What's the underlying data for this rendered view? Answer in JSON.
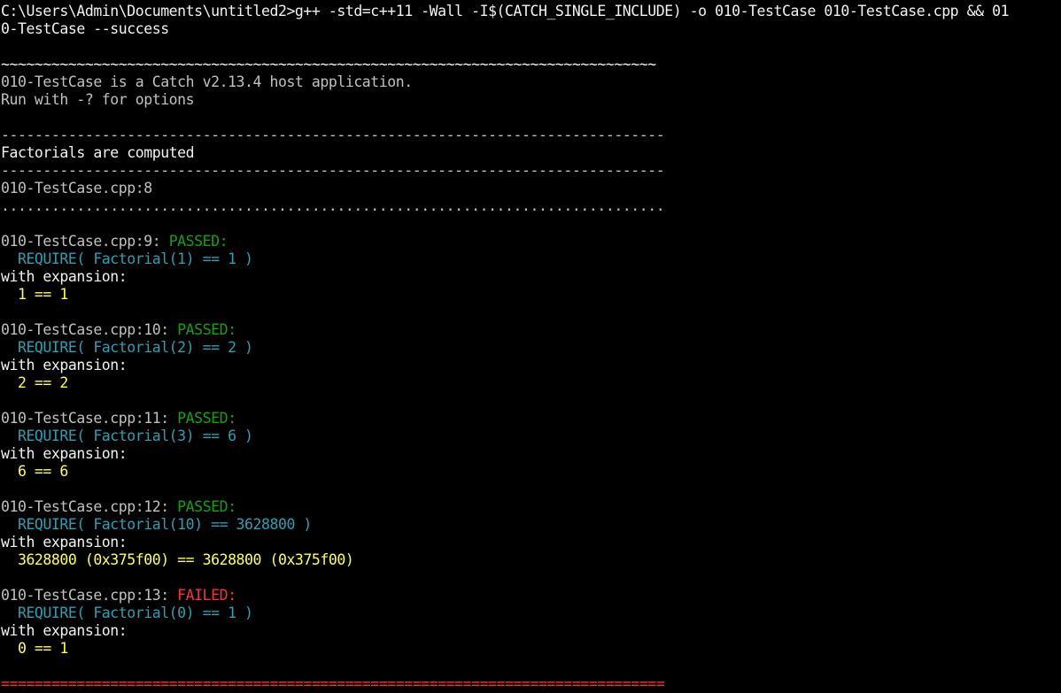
{
  "console": {
    "lines": [
      {
        "segments": [
          {
            "text": "C:\\Users\\Admin\\Documents\\untitled2>g++ -std=c++11 -Wall -I$(CATCH_SINGLE_INCLUDE) -o 010-TestCase 010-TestCase.cpp && 01",
            "color": "#f2f2f2"
          }
        ]
      },
      {
        "segments": [
          {
            "text": "0-TestCase --success",
            "color": "#f2f2f2"
          }
        ]
      },
      {
        "segments": [
          {
            "text": "",
            "color": "#c0c0c0"
          }
        ]
      },
      {
        "segments": [
          {
            "text": "~~~~~~~~~~~~~~~~~~~~~~~~~~~~~~~~~~~~~~~~~~~~~~~~~~~~~~~~~~~~~~~~~~~~~~~~~~~~~~",
            "color": "#f2f2f2"
          }
        ]
      },
      {
        "segments": [
          {
            "text": "010-TestCase is a Catch v2.13.4 host application.",
            "color": "#c0c0c0"
          }
        ]
      },
      {
        "segments": [
          {
            "text": "Run with -? for options",
            "color": "#c0c0c0"
          }
        ]
      },
      {
        "segments": [
          {
            "text": "",
            "color": "#c0c0c0"
          }
        ]
      },
      {
        "segments": [
          {
            "text": "-------------------------------------------------------------------------------",
            "color": "#c0c0c0"
          }
        ]
      },
      {
        "segments": [
          {
            "text": "Factorials are computed",
            "color": "#f2f2f2"
          }
        ]
      },
      {
        "segments": [
          {
            "text": "-------------------------------------------------------------------------------",
            "color": "#c0c0c0"
          }
        ]
      },
      {
        "segments": [
          {
            "text": "010-TestCase.cpp:8",
            "color": "#c0c0c0"
          }
        ]
      },
      {
        "segments": [
          {
            "text": "...............................................................................",
            "color": "#c0c0c0"
          }
        ]
      },
      {
        "segments": [
          {
            "text": "",
            "color": "#c0c0c0"
          }
        ]
      },
      {
        "segments": [
          {
            "text": "010-TestCase.cpp:9: ",
            "color": "#c0c0c0"
          },
          {
            "text": "PASSED:",
            "color": "#13a10e"
          }
        ]
      },
      {
        "segments": [
          {
            "text": "  REQUIRE( Factorial(1) == 1 )",
            "color": "#2aa1b3"
          }
        ]
      },
      {
        "segments": [
          {
            "text": "with expansion:",
            "color": "#f2f2f2"
          }
        ]
      },
      {
        "segments": [
          {
            "text": "  1 == 1",
            "color": "#ffff55"
          }
        ]
      },
      {
        "segments": [
          {
            "text": "",
            "color": "#c0c0c0"
          }
        ]
      },
      {
        "segments": [
          {
            "text": "010-TestCase.cpp:10: ",
            "color": "#c0c0c0"
          },
          {
            "text": "PASSED:",
            "color": "#13a10e"
          }
        ]
      },
      {
        "segments": [
          {
            "text": "  REQUIRE( Factorial(2) == 2 )",
            "color": "#2aa1b3"
          }
        ]
      },
      {
        "segments": [
          {
            "text": "with expansion:",
            "color": "#f2f2f2"
          }
        ]
      },
      {
        "segments": [
          {
            "text": "  2 == 2",
            "color": "#ffff55"
          }
        ]
      },
      {
        "segments": [
          {
            "text": "",
            "color": "#c0c0c0"
          }
        ]
      },
      {
        "segments": [
          {
            "text": "010-TestCase.cpp:11: ",
            "color": "#c0c0c0"
          },
          {
            "text": "PASSED:",
            "color": "#13a10e"
          }
        ]
      },
      {
        "segments": [
          {
            "text": "  REQUIRE( Factorial(3) == 6 )",
            "color": "#2aa1b3"
          }
        ]
      },
      {
        "segments": [
          {
            "text": "with expansion:",
            "color": "#f2f2f2"
          }
        ]
      },
      {
        "segments": [
          {
            "text": "  6 == 6",
            "color": "#ffff55"
          }
        ]
      },
      {
        "segments": [
          {
            "text": "",
            "color": "#c0c0c0"
          }
        ]
      },
      {
        "segments": [
          {
            "text": "010-TestCase.cpp:12: ",
            "color": "#c0c0c0"
          },
          {
            "text": "PASSED:",
            "color": "#13a10e"
          }
        ]
      },
      {
        "segments": [
          {
            "text": "  REQUIRE( Factorial(10) == 3628800 )",
            "color": "#2aa1b3"
          }
        ]
      },
      {
        "segments": [
          {
            "text": "with expansion:",
            "color": "#f2f2f2"
          }
        ]
      },
      {
        "segments": [
          {
            "text": "  3628800 (0x375f00) == 3628800 (0x375f00)",
            "color": "#ffff55"
          }
        ]
      },
      {
        "segments": [
          {
            "text": "",
            "color": "#c0c0c0"
          }
        ]
      },
      {
        "segments": [
          {
            "text": "010-TestCase.cpp:13: ",
            "color": "#c0c0c0"
          },
          {
            "text": "FAILED:",
            "color": "#ff3030"
          }
        ]
      },
      {
        "segments": [
          {
            "text": "  REQUIRE( Factorial(0) == 1 )",
            "color": "#2aa1b3"
          }
        ]
      },
      {
        "segments": [
          {
            "text": "with expansion:",
            "color": "#f2f2f2"
          }
        ]
      },
      {
        "segments": [
          {
            "text": "  0 == 1",
            "color": "#ffff55"
          }
        ]
      },
      {
        "segments": [
          {
            "text": "",
            "color": "#c0c0c0"
          }
        ]
      },
      {
        "segments": [
          {
            "text": "===============================================================================",
            "color": "#ff3030"
          }
        ]
      }
    ]
  },
  "theme": {
    "background": "#000000",
    "default_text": "#c0c0c0",
    "passed": "#13a10e",
    "failed": "#ff3030",
    "expression": "#2aa1b3",
    "expansion": "#ffff55"
  }
}
